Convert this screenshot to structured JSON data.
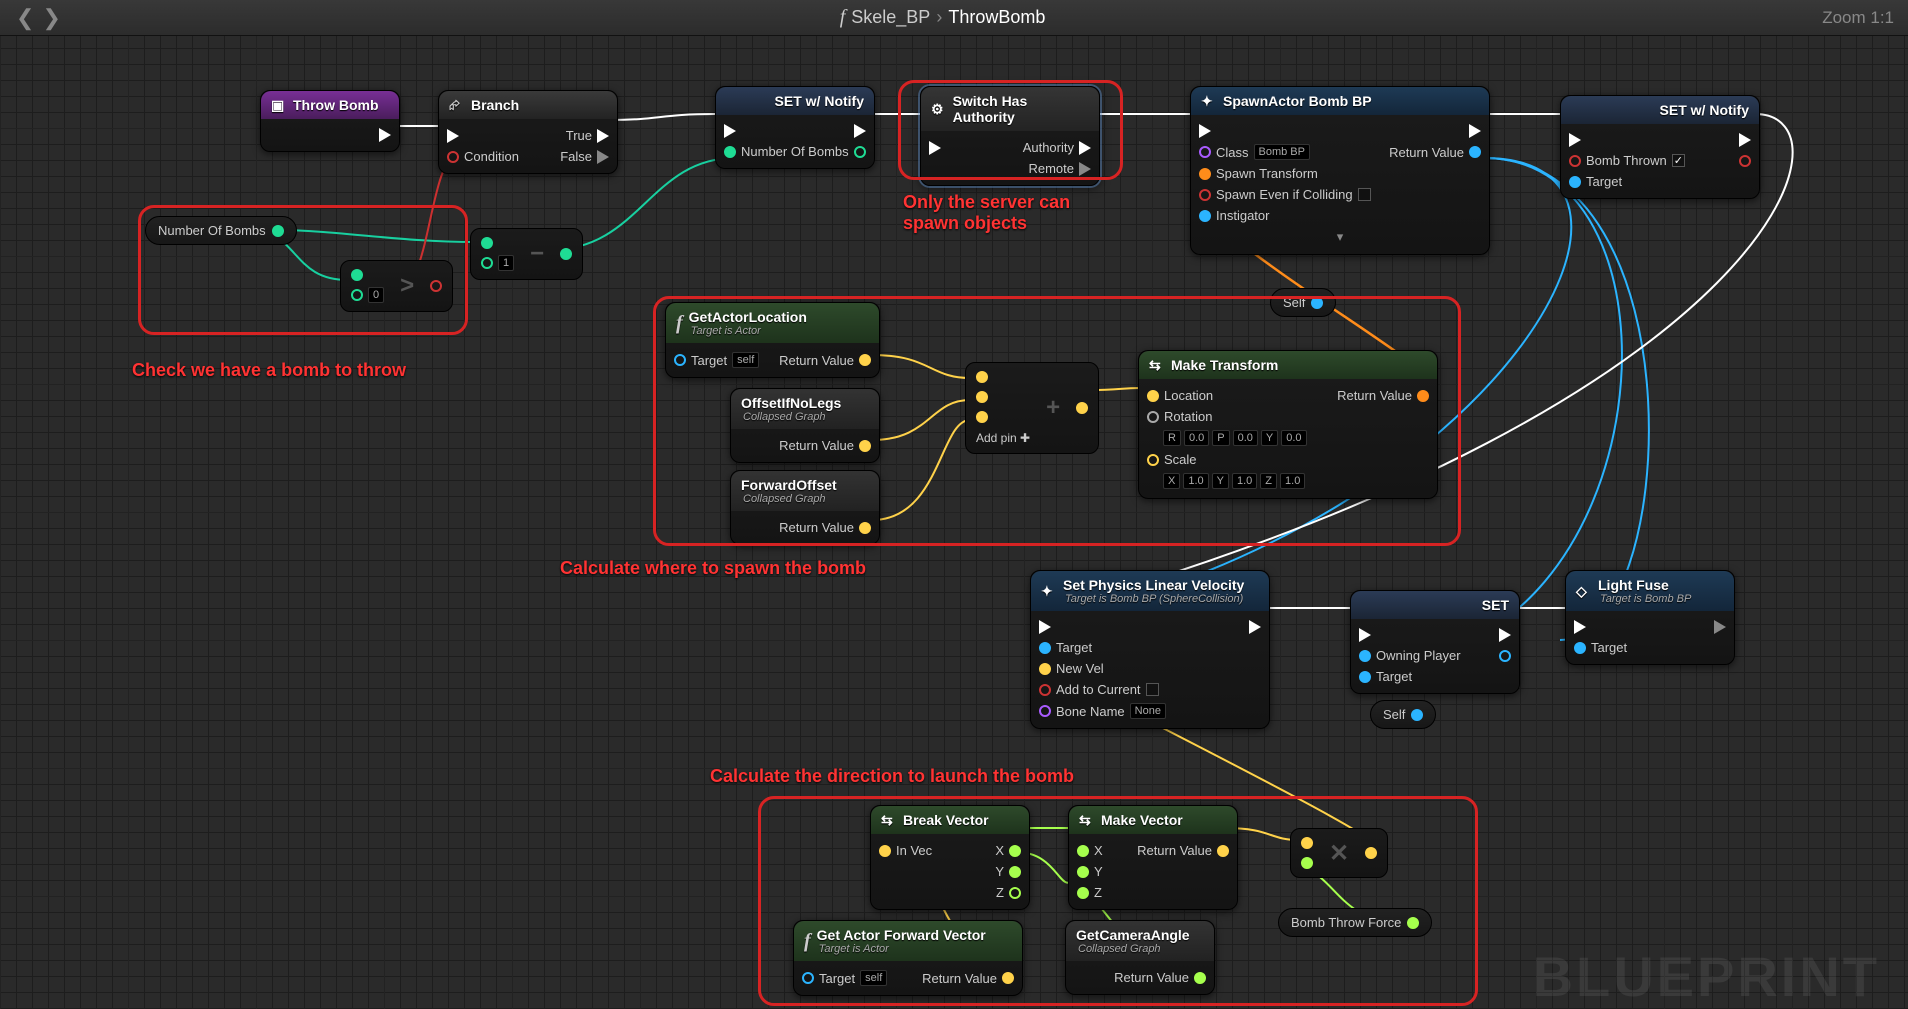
{
  "topbar": {
    "blueprint_name": "Skele_BP",
    "function_name": "ThrowBomb",
    "zoom": "Zoom 1:1"
  },
  "watermark": "BLUEPRINT",
  "annotations": {
    "check_bomb": "Check we have a bomb to throw",
    "server_only": "Only the server can spawn objects",
    "calc_spawn": "Calculate where to spawn the bomb",
    "calc_dir": "Calculate the direction to launch the bomb"
  },
  "nodes": {
    "event": {
      "title": "Throw Bomb"
    },
    "branch": {
      "title": "Branch",
      "out_true": "True",
      "out_false": "False",
      "in_cond": "Condition"
    },
    "set1": {
      "title": "SET w/ Notify",
      "var": "Number Of Bombs"
    },
    "switch": {
      "title": "Switch Has Authority",
      "out_auth": "Authority",
      "out_remote": "Remote"
    },
    "spawn": {
      "title": "SpawnActor Bomb BP",
      "class": "Class",
      "class_val": "Bomb BP",
      "transform": "Spawn Transform",
      "collide": "Spawn Even if Colliding",
      "instig": "Instigator",
      "retval": "Return Value"
    },
    "set2": {
      "title": "SET w/ Notify",
      "var": "Bomb Thrown",
      "target": "Target"
    },
    "self1": "Self",
    "num_bombs_var": "Number Of Bombs",
    "compare_val": "0",
    "minus_val": "1",
    "get_loc": {
      "title": "GetActorLocation",
      "sub": "Target is Actor",
      "target": "Target",
      "self": "self",
      "ret": "Return Value"
    },
    "offset": {
      "title": "OffsetIfNoLegs",
      "sub": "Collapsed Graph",
      "ret": "Return Value"
    },
    "forward": {
      "title": "ForwardOffset",
      "sub": "Collapsed Graph",
      "ret": "Return Value"
    },
    "add": {
      "label": "Add pin"
    },
    "make_t": {
      "title": "Make Transform",
      "loc": "Location",
      "rot": "Rotation",
      "scale": "Scale",
      "ret": "Return Value",
      "r": "0.0",
      "p": "0.0",
      "y": "0.0",
      "sx": "1.0",
      "sy": "1.0",
      "sz": "1.0",
      "rl": "R",
      "pl": "P",
      "yl": "Y",
      "xl": "X",
      "yl2": "Y",
      "zl": "Z"
    },
    "phys": {
      "title": "Set Physics Linear Velocity",
      "sub": "Target is Bomb BP (SphereCollision)",
      "target": "Target",
      "newvel": "New Vel",
      "add": "Add to Current",
      "bone": "Bone Name",
      "bone_val": "None"
    },
    "set3": {
      "title": "SET",
      "var": "Owning Player",
      "target": "Target"
    },
    "light": {
      "title": "Light Fuse",
      "sub": "Target is Bomb BP",
      "target": "Target"
    },
    "self2": "Self",
    "break": {
      "title": "Break Vector",
      "inv": "In Vec",
      "x": "X",
      "y": "Y",
      "z": "Z"
    },
    "makev": {
      "title": "Make Vector",
      "x": "X",
      "y": "Y",
      "z": "Z",
      "ret": "Return Value"
    },
    "getfwd": {
      "title": "Get Actor Forward Vector",
      "sub": "Target is Actor",
      "target": "Target",
      "self": "self",
      "ret": "Return Value"
    },
    "camangle": {
      "title": "GetCameraAngle",
      "sub": "Collapsed Graph",
      "ret": "Return Value"
    },
    "throwforce": "Bomb Throw Force"
  }
}
